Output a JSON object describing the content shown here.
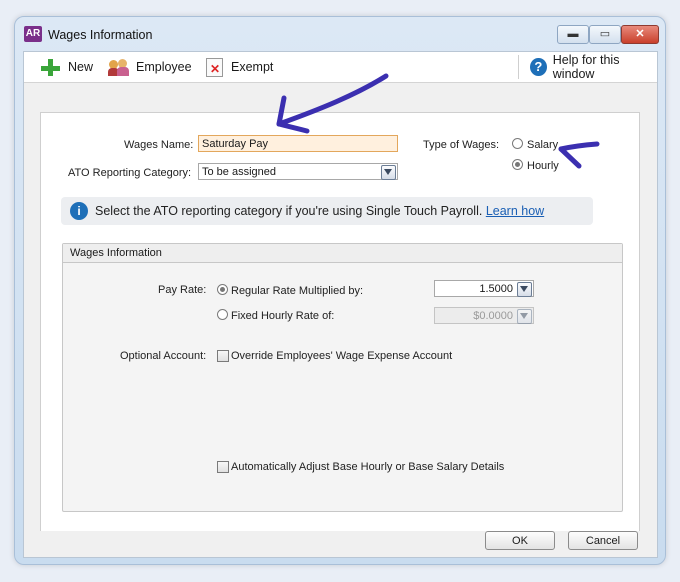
{
  "window": {
    "app_badge": "AR",
    "title": "Wages Information",
    "minimize": "▬",
    "maximize": "▭",
    "close": "✕"
  },
  "toolbar": {
    "new_label": "New",
    "employee_label": "Employee",
    "exempt_label": "Exempt",
    "help_label": "Help for this window"
  },
  "form": {
    "wages_name_label": "Wages Name:",
    "wages_name_value": "Saturday Pay",
    "ato_label": "ATO Reporting Category:",
    "ato_value": "To be assigned",
    "type_label": "Type of Wages:",
    "salary_label": "Salary",
    "hourly_label": "Hourly",
    "type_selected": "Hourly"
  },
  "info": {
    "text": "Select the ATO reporting category if you're using Single Touch Payroll.",
    "link": "Learn how"
  },
  "group": {
    "title": "Wages Information",
    "pay_rate_label": "Pay Rate:",
    "regular_label": "Regular Rate Multiplied by:",
    "regular_value": "1.5000",
    "fixed_label": "Fixed Hourly Rate of:",
    "fixed_value": "$0.0000",
    "optional_label": "Optional Account:",
    "override_label": "Override Employees' Wage Expense Account",
    "auto_adjust_label": "Automatically Adjust Base Hourly or Base Salary Details"
  },
  "buttons": {
    "ok": "OK",
    "cancel": "Cancel"
  },
  "colors": {
    "annotation": "#3b2fb0",
    "highlight_field": "#fff0de",
    "brand": "#7a2f8a"
  }
}
